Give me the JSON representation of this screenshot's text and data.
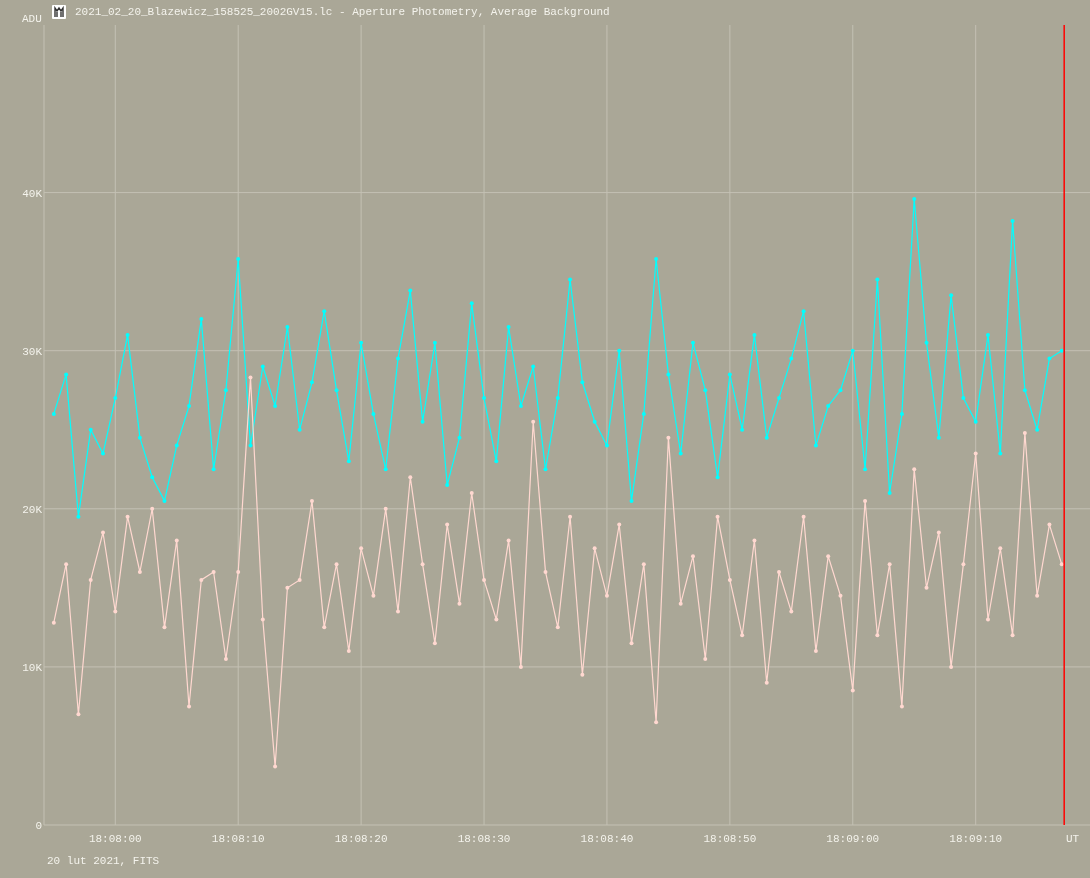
{
  "window": {
    "title": "2021_02_20_Blazewicz_158525_2002GV15.lc - Aperture Photometry, Average Background"
  },
  "chart": {
    "chart_data": {
      "type": "line",
      "xlabel": "UT",
      "ylabel": "ADU",
      "x": [
        65275,
        65276,
        65277,
        65278,
        65279,
        65280,
        65281,
        65282,
        65283,
        65284,
        65285,
        65286,
        65287,
        65288,
        65289,
        65290,
        65291,
        65292,
        65293,
        65294,
        65295,
        65296,
        65297,
        65298,
        65299,
        65300,
        65301,
        65302,
        65303,
        65304,
        65305,
        65306,
        65307,
        65308,
        65309,
        65310,
        65311,
        65312,
        65313,
        65314,
        65315,
        65316,
        65317,
        65318,
        65319,
        65320,
        65321,
        65322,
        65323,
        65324,
        65325,
        65326,
        65327,
        65328,
        65329,
        65330,
        65331,
        65332,
        65333,
        65334,
        65335,
        65336,
        65337,
        65338,
        65339,
        65340,
        65341,
        65342,
        65343,
        65344,
        65345,
        65346,
        65347,
        65348,
        65349,
        65350,
        65351,
        65352,
        65353,
        65354,
        65355,
        65356,
        65357
      ],
      "series": [
        {
          "color": "#00ffff",
          "values": [
            26000,
            28500,
            19500,
            25000,
            23500,
            27000,
            31000,
            24500,
            22000,
            20500,
            24000,
            26500,
            32000,
            22500,
            27500,
            35800,
            24000,
            29000,
            26500,
            31500,
            25000,
            28000,
            32500,
            27500,
            23000,
            30500,
            26000,
            22500,
            29500,
            33800,
            25500,
            30500,
            21500,
            24500,
            33000,
            27000,
            23000,
            31500,
            26500,
            29000,
            22500,
            27000,
            34500,
            28000,
            25500,
            24000,
            30000,
            20500,
            26000,
            35800,
            28500,
            23500,
            30500,
            27500,
            22000,
            28500,
            25000,
            31000,
            24500,
            27000,
            29500,
            32500,
            24000,
            26500,
            27500,
            30000,
            22500,
            34500,
            21000,
            26000,
            39600,
            30500,
            24500,
            33500,
            27000,
            25500,
            31000,
            23500,
            38200,
            27500,
            25000,
            29500,
            30000
          ]
        },
        {
          "color": "#ffd8d0",
          "values": [
            12800,
            16500,
            7000,
            15500,
            18500,
            13500,
            19500,
            16000,
            20000,
            12500,
            18000,
            7500,
            15500,
            16000,
            10500,
            16000,
            28300,
            13000,
            3700,
            15000,
            15500,
            20500,
            12500,
            16500,
            11000,
            17500,
            14500,
            20000,
            13500,
            22000,
            16500,
            11500,
            19000,
            14000,
            21000,
            15500,
            13000,
            18000,
            10000,
            25500,
            16000,
            12500,
            19500,
            9500,
            17500,
            14500,
            19000,
            11500,
            16500,
            6500,
            24500,
            14000,
            17000,
            10500,
            19500,
            15500,
            12000,
            18000,
            9000,
            16000,
            13500,
            19500,
            11000,
            17000,
            14500,
            8500,
            20500,
            12000,
            16500,
            7500,
            22500,
            15000,
            18500,
            10000,
            16500,
            23500,
            13000,
            17500,
            12000,
            24800,
            14500,
            19000,
            16500
          ]
        }
      ],
      "xlim": [
        65274.2,
        65359.3
      ],
      "ylim": [
        0,
        50600
      ],
      "xticks": [
        {
          "value": 65280,
          "label": "18:08:00"
        },
        {
          "value": 65290,
          "label": "18:08:10"
        },
        {
          "value": 65300,
          "label": "18:08:20"
        },
        {
          "value": 65310,
          "label": "18:08:30"
        },
        {
          "value": 65320,
          "label": "18:08:40"
        },
        {
          "value": 65330,
          "label": "18:08:50"
        },
        {
          "value": 65340,
          "label": "18:09:00"
        },
        {
          "value": 65350,
          "label": "18:09:10"
        }
      ],
      "yticks": [
        {
          "value": 0,
          "label": "0"
        },
        {
          "value": 10000,
          "label": "10K"
        },
        {
          "value": 20000,
          "label": "20K"
        },
        {
          "value": 30000,
          "label": "30K"
        },
        {
          "value": 40000,
          "label": "40K"
        }
      ],
      "grid": true,
      "ref_lines": [
        {
          "axis": "x",
          "value": 65357.2,
          "color": "#ff0000"
        }
      ]
    }
  },
  "footer": "20 lut 2021, FITS"
}
